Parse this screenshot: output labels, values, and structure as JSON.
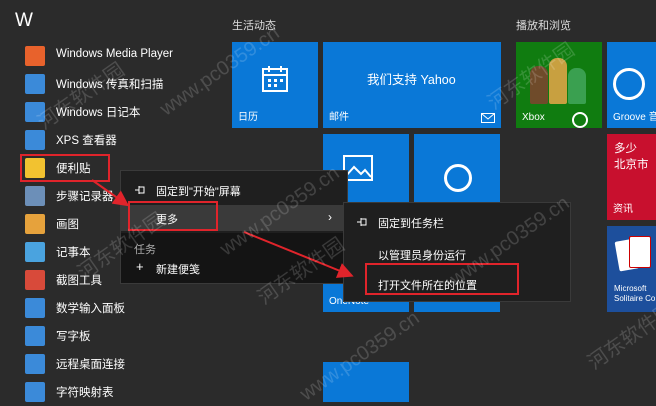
{
  "applist": {
    "letter": "W",
    "items": [
      {
        "label": "Windows Media Player",
        "icon": "media-player-icon",
        "color": "#e8622c"
      },
      {
        "label": "Windows 传真和扫描",
        "icon": "fax-scan-icon",
        "color": "#3b8ad9"
      },
      {
        "label": "Windows 日记本",
        "icon": "journal-icon",
        "color": "#3b8ad9"
      },
      {
        "label": "XPS 查看器",
        "icon": "xps-viewer-icon",
        "color": "#3b8ad9"
      },
      {
        "label": "便利贴",
        "icon": "sticky-notes-icon",
        "color": "#f2c230"
      },
      {
        "label": "步骤记录器",
        "icon": "steps-recorder-icon",
        "color": "#6c8fb8"
      },
      {
        "label": "画图",
        "icon": "paint-icon",
        "color": "#e6a23c"
      },
      {
        "label": "记事本",
        "icon": "notepad-icon",
        "color": "#4aa3df"
      },
      {
        "label": "截图工具",
        "icon": "snipping-tool-icon",
        "color": "#d84a3a"
      },
      {
        "label": "数学输入面板",
        "icon": "math-input-icon",
        "color": "#3b8ad9"
      },
      {
        "label": "写字板",
        "icon": "wordpad-icon",
        "color": "#3b8ad9"
      },
      {
        "label": "远程桌面连接",
        "icon": "remote-desktop-icon",
        "color": "#3b8ad9"
      },
      {
        "label": "字符映射表",
        "icon": "charmap-icon",
        "color": "#3b8ad9"
      }
    ]
  },
  "tiles": {
    "group1_title": "生活动态",
    "group2_title": "播放和浏览",
    "calendar": "日历",
    "mail_title": "我们支持 Yahoo",
    "mail": "邮件",
    "xbox": "Xbox",
    "groove": "Groove 音",
    "news_line1": "多少",
    "news_line2": "北京市",
    "news_label": "资讯",
    "solitaire_line1": "Microsoft",
    "solitaire_line2": "Solitaire Co",
    "onenote_partial": "OneNote"
  },
  "menu1": {
    "pin_start": "固定到\"开始\"屏幕",
    "more": "更多",
    "section": "任务",
    "new_note": "新建便笺"
  },
  "menu2": {
    "pin_taskbar": "固定到任务栏",
    "run_admin": "以管理员身份运行",
    "open_location": "打开文件所在的位置"
  },
  "watermark": [
    "河东软件园",
    "www.pc0359.cn"
  ],
  "colors": {
    "tile_blue": "#0a78d7",
    "tile_green": "#107c10",
    "news_red": "#c8102e",
    "highlight_red": "#e0242b",
    "menu_bg": "#1f1f1f"
  }
}
